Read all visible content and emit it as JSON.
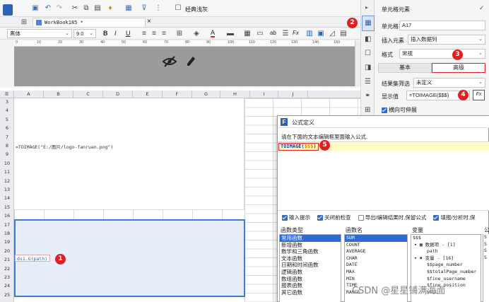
{
  "toolbar": {
    "classic_label": "经典浅灰",
    "workbook_tab": "WorkBook185 *",
    "font_name": "黑体",
    "font_size": "9.0",
    "bold": "B",
    "italic": "I",
    "underline": "U",
    "text_a": "A",
    "ab_label": "ab",
    "fx_label": "Fx"
  },
  "ruler": {
    "marks": [
      "0",
      "10",
      "20",
      "30",
      "40",
      "50",
      "60",
      "70",
      "80",
      "90",
      "100",
      "110",
      "120",
      "130",
      "140",
      "150"
    ]
  },
  "grid": {
    "columns": [
      "A",
      "B",
      "C",
      "D",
      "E",
      "F",
      "G",
      "H",
      "I",
      "J"
    ],
    "rows": [
      "3",
      "4",
      "5",
      "6",
      "7",
      "8",
      "9",
      "10",
      "11",
      "12",
      "13",
      "14",
      "15",
      "16",
      "17",
      "18",
      "19",
      "20",
      "21",
      "22",
      "23",
      "24",
      "25"
    ],
    "cell_formula": "=TOIMAGE(\"E:/图片/logo-fanruan.png\")",
    "cell_ds": "ds1.G(path)"
  },
  "right_panel": {
    "title": "单元格元素",
    "cell_label": "单元格",
    "cell_value": "A17",
    "insert_label": "插入元素",
    "insert_value": "插入数据列",
    "format_label": "格式",
    "format_value": "常规",
    "tab_basic": "基本",
    "tab_advanced": "高级",
    "filter_label": "结果集筛选",
    "filter_value": "未定义",
    "display_label": "显示值",
    "display_value": "=TOIMAGE($$$)",
    "fx_button": "Fx",
    "extend_label": "横向可伸展"
  },
  "dialog": {
    "title": "公式定义",
    "instruction": "请在下面的文本编辑框里面输入公式.",
    "formula_prefix": "TOIMAGE(",
    "formula_arg": "$$$",
    "formula_suffix": ")",
    "opt_hint": "输入提示",
    "opt_check": "关闭前检查",
    "opt_export": "导出/编辑结果时,保留公式",
    "opt_keep": "填报/分析时,保",
    "col_functype": "函数类型",
    "col_funcname": "函数名",
    "col_vars": "变量",
    "col_extra": "公",
    "func_types": [
      "常用函数",
      "新增函数",
      "数学和三角函数",
      "文本函数",
      "日期和时间函数",
      "逻辑函数",
      "数组函数",
      "报表函数",
      "其它函数"
    ],
    "func_names": [
      "SUM",
      "COUNT",
      "AVERAGE",
      "CHAR",
      "DATE",
      "MAX",
      "MIN",
      "TIME",
      "RANGE"
    ],
    "vars": [
      "$$$",
      "数据项 - [1]",
      "path",
      "变量 - [16]",
      "$$page_number",
      "$$totalPage_number",
      "$fine_username",
      "$fine_position",
      "NULL"
    ],
    "extra_letters": [
      "S",
      "S",
      "S",
      "S"
    ]
  },
  "badges": [
    "1",
    "2",
    "3",
    "4",
    "5"
  ],
  "watermark": "CSDN @星星铺满海面"
}
